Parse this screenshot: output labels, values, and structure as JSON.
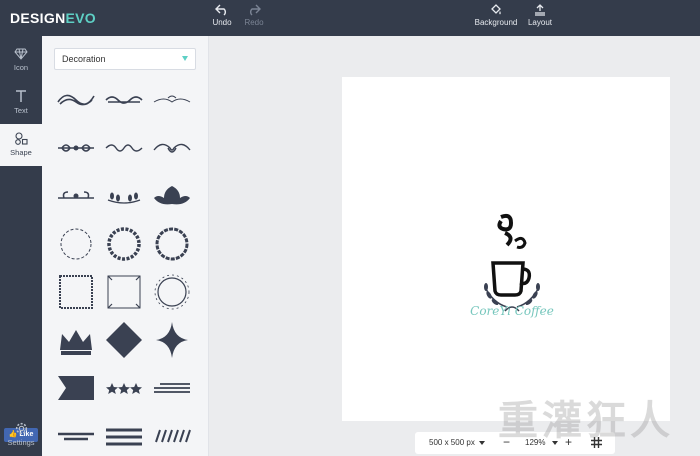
{
  "app": {
    "logo_part1": "DESIGN",
    "logo_part2": "EVO"
  },
  "toolbar": {
    "undo": "Undo",
    "redo": "Redo",
    "background": "Background",
    "layout": "Layout"
  },
  "nav": {
    "icon": "Icon",
    "text": "Text",
    "shape": "Shape",
    "like": "Like",
    "settings": "Settings"
  },
  "panel": {
    "category": "Decoration"
  },
  "canvas": {
    "brand_text": "CoreYi Coffee"
  },
  "bottombar": {
    "size": "500 x 500 px",
    "zoom": "129%"
  },
  "colors": {
    "accent": "#5ed0c5",
    "chrome": "#343c4b",
    "shape": "#3a4152",
    "brand": "#77c7bd"
  },
  "watermark": "重灌狂人"
}
